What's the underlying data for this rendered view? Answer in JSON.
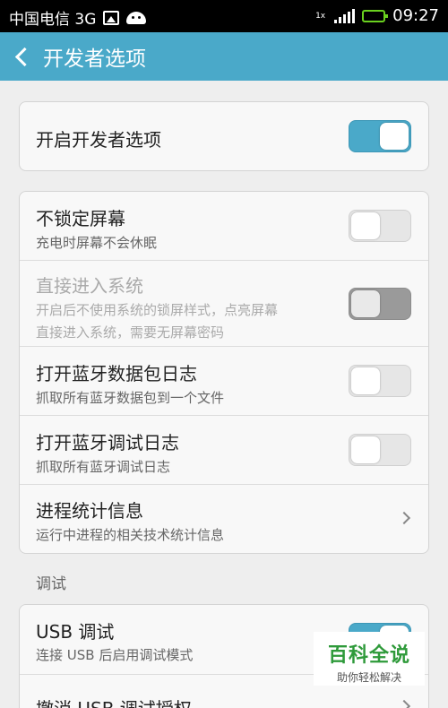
{
  "status_bar": {
    "carrier": "中国电信 3G",
    "signal_label": "1x",
    "time": "09:27"
  },
  "header": {
    "title": "开发者选项"
  },
  "master": {
    "label": "开启开发者选项",
    "enabled": true
  },
  "settings": [
    {
      "title": "不锁定屏幕",
      "subtitle": "充电时屏幕不会休眠",
      "switch": false,
      "disabled": false
    },
    {
      "title": "直接进入系统",
      "subtitle_line1": "开启后不使用系统的锁屏样式，点亮屏幕",
      "subtitle_line2": "直接进入系统，需要无屏幕密码",
      "switch": false,
      "disabled": true
    },
    {
      "title": "打开蓝牙数据包日志",
      "subtitle": "抓取所有蓝牙数据包到一个文件",
      "switch": false,
      "disabled": false
    },
    {
      "title": "打开蓝牙调试日志",
      "subtitle": "抓取所有蓝牙调试日志",
      "switch": false,
      "disabled": false
    },
    {
      "title": "进程统计信息",
      "subtitle": "运行中进程的相关技术统计信息"
    }
  ],
  "debug_section": {
    "header": "调试",
    "usb_debug_title": "USB 调试",
    "usb_debug_subtitle": "连接 USB 后启用调试模式",
    "usb_debug_on": true,
    "revoke_title": "撤消 USB 调试授权"
  },
  "watermark": {
    "main": "百科全说",
    "sub": "助你轻松解决"
  },
  "colors": {
    "accent": "#4aa9c9",
    "battery": "#6ad11f",
    "watermark": "#2e9a3a"
  }
}
